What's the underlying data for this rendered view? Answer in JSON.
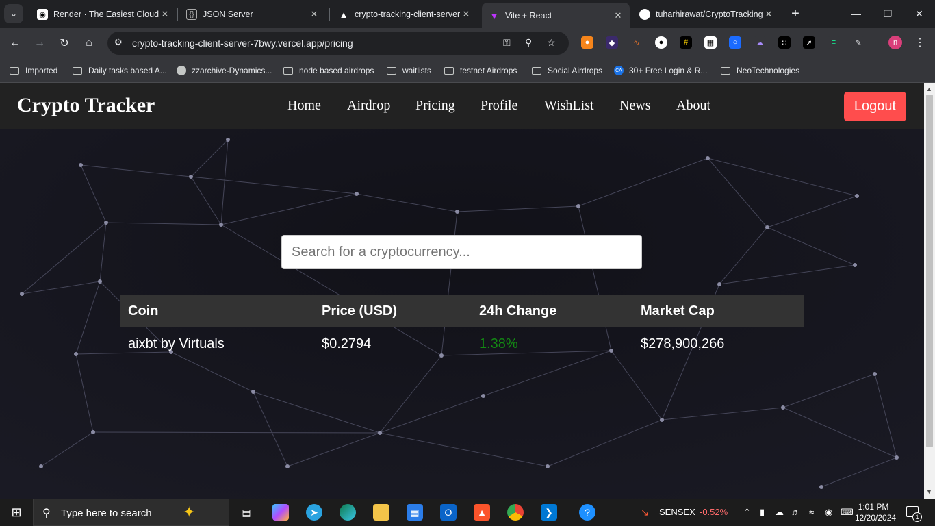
{
  "browser": {
    "tabs": [
      {
        "title": "Render · The Easiest Cloud F",
        "active": false
      },
      {
        "title": "JSON Server",
        "active": false
      },
      {
        "title": "crypto-tracking-client-server",
        "active": false
      },
      {
        "title": "Vite + React",
        "active": true
      },
      {
        "title": "tuharhirawat/CryptoTracking",
        "active": false
      }
    ],
    "url": "crypto-tracking-client-server-7bwy.vercel.app/pricing",
    "bookmarks": [
      {
        "label": "Imported",
        "icon": "folder-icon"
      },
      {
        "label": "Daily tasks based A...",
        "icon": "folder-icon"
      },
      {
        "label": "zzarchive-Dynamics...",
        "icon": "github-icon"
      },
      {
        "label": "node based airdrops",
        "icon": "folder-icon"
      },
      {
        "label": "waitlists",
        "icon": "folder-icon"
      },
      {
        "label": "testnet Airdrops",
        "icon": "folder-icon"
      },
      {
        "label": "Social Airdrops",
        "icon": "folder-icon"
      },
      {
        "label": "30+ Free Login & R...",
        "icon": "cryptoapi-icon"
      },
      {
        "label": "NeoTechnologies",
        "icon": "folder-icon"
      }
    ],
    "profile_initial": "n"
  },
  "site": {
    "brand": "Crypto Tracker",
    "nav": [
      "Home",
      "Airdrop",
      "Pricing",
      "Profile",
      "WishList",
      "News",
      "About"
    ],
    "logout_label": "Logout",
    "search_placeholder": "Search for a cryptocurrency...",
    "table": {
      "headers": [
        "Coin",
        "Price (USD)",
        "24h Change",
        "Market Cap"
      ],
      "rows": [
        {
          "coin": "aixbt by Virtuals",
          "price": "$0.2794",
          "change": "1.38%",
          "market_cap": "$278,900,266"
        }
      ]
    },
    "colors": {
      "navbar": "#222222",
      "logout": "#ff4d4d",
      "positive_change": "#138a13",
      "table_header": "#333333"
    }
  },
  "taskbar": {
    "search_placeholder": "Type here to search",
    "ticker_name": "SENSEX",
    "ticker_value": "-0.52%",
    "time": "1:01 PM",
    "date": "12/20/2024",
    "notification_count": "1"
  }
}
